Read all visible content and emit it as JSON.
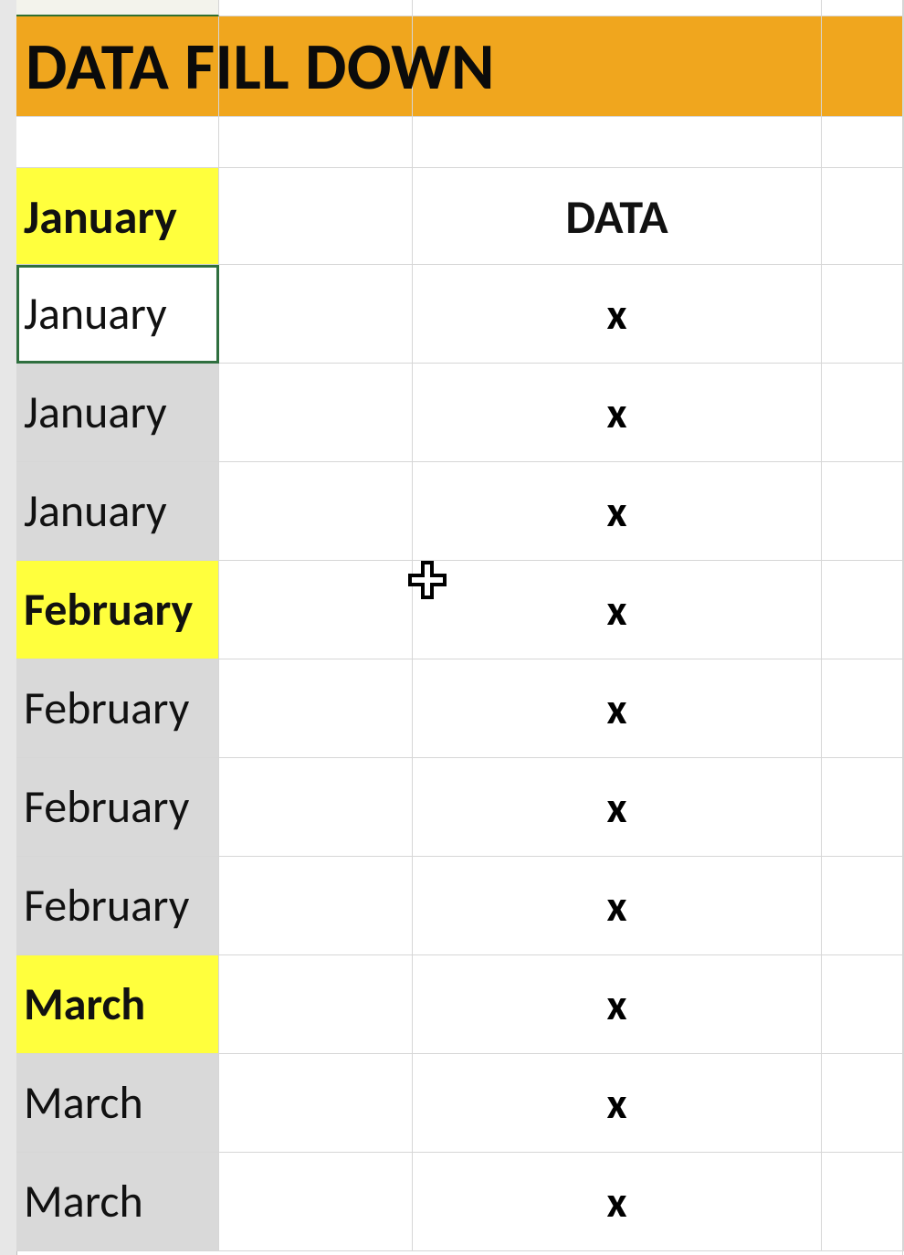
{
  "title": "DATA FILL DOWN",
  "colD_header": "DATA",
  "colors": {
    "title_bg": "#f0a61e",
    "highlight_bg": "#ffff3d",
    "selection_bg": "#d9d9d9",
    "active_cell_border": "#2f6f3f"
  },
  "cursor": "plus-cursor",
  "rows": [
    {
      "month": "January",
      "data": "",
      "highlight": true,
      "bold": true,
      "sel": false,
      "active": false
    },
    {
      "month": "January",
      "data": "x",
      "highlight": false,
      "bold": false,
      "sel": true,
      "active": true
    },
    {
      "month": "January",
      "data": "x",
      "highlight": false,
      "bold": false,
      "sel": true,
      "active": false
    },
    {
      "month": "January",
      "data": "x",
      "highlight": false,
      "bold": false,
      "sel": true,
      "active": false
    },
    {
      "month": "February",
      "data": "x",
      "highlight": true,
      "bold": true,
      "sel": false,
      "active": false
    },
    {
      "month": "February",
      "data": "x",
      "highlight": false,
      "bold": false,
      "sel": true,
      "active": false
    },
    {
      "month": "February",
      "data": "x",
      "highlight": false,
      "bold": false,
      "sel": true,
      "active": false
    },
    {
      "month": "February",
      "data": "x",
      "highlight": false,
      "bold": false,
      "sel": true,
      "active": false
    },
    {
      "month": "March",
      "data": "x",
      "highlight": true,
      "bold": true,
      "sel": false,
      "active": false
    },
    {
      "month": "March",
      "data": "x",
      "highlight": false,
      "bold": false,
      "sel": true,
      "active": false
    },
    {
      "month": "March",
      "data": "x",
      "highlight": false,
      "bold": false,
      "sel": true,
      "active": false
    }
  ]
}
